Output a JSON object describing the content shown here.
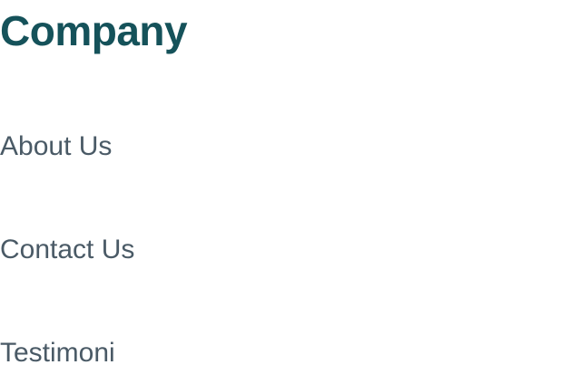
{
  "company_column": {
    "heading": "Company",
    "links": [
      {
        "label": "About Us"
      },
      {
        "label": "Contact Us"
      },
      {
        "label": "Testimoni"
      }
    ]
  },
  "colors": {
    "heading": "#15525a",
    "link": "#4a5a66",
    "background": "#ffffff"
  }
}
